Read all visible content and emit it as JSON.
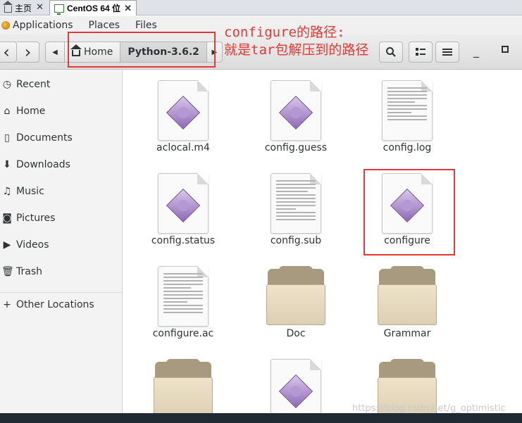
{
  "vm_tabs": [
    {
      "label": "主页"
    },
    {
      "label": "CentOS 64 位"
    }
  ],
  "topbar": {
    "applications": "Applications",
    "places": "Places",
    "files": "Files"
  },
  "toolbar": {
    "back": "‹",
    "forward": "›",
    "path": [
      "Home",
      "Python-3.6.2"
    ],
    "search_icon": "search-icon",
    "view_icon": "list-view-icon",
    "menu_icon": "hamburger-icon",
    "minimize": "_",
    "maximize": "▫"
  },
  "annotation": {
    "line1": "configure的路径:",
    "line2": "就是tar包解压到的路径",
    "color": "#e53935"
  },
  "sidebar": {
    "items": [
      {
        "label": "Recent",
        "icon": "clock-icon"
      },
      {
        "label": "Home",
        "icon": "home-icon"
      },
      {
        "label": "Documents",
        "icon": "document-icon"
      },
      {
        "label": "Downloads",
        "icon": "download-icon"
      },
      {
        "label": "Music",
        "icon": "music-icon"
      },
      {
        "label": "Pictures",
        "icon": "camera-icon"
      },
      {
        "label": "Videos",
        "icon": "video-icon"
      },
      {
        "label": "Trash",
        "icon": "trash-icon"
      },
      {
        "label": "Other Locations",
        "icon": "plus-icon"
      }
    ]
  },
  "files": [
    {
      "name": "aclocal.m4",
      "type": "script"
    },
    {
      "name": "config.guess",
      "type": "script"
    },
    {
      "name": "config.log",
      "type": "text"
    },
    {
      "name": "config.status",
      "type": "script"
    },
    {
      "name": "config.sub",
      "type": "text"
    },
    {
      "name": "configure",
      "type": "script"
    },
    {
      "name": "configure.ac",
      "type": "text"
    },
    {
      "name": "Doc",
      "type": "folder"
    },
    {
      "name": "Grammar",
      "type": "folder"
    },
    {
      "name": "",
      "type": "folder"
    },
    {
      "name": "",
      "type": "script"
    },
    {
      "name": "",
      "type": "folder"
    }
  ],
  "watermark": "https://blog.csdn.net/g_optimistic"
}
